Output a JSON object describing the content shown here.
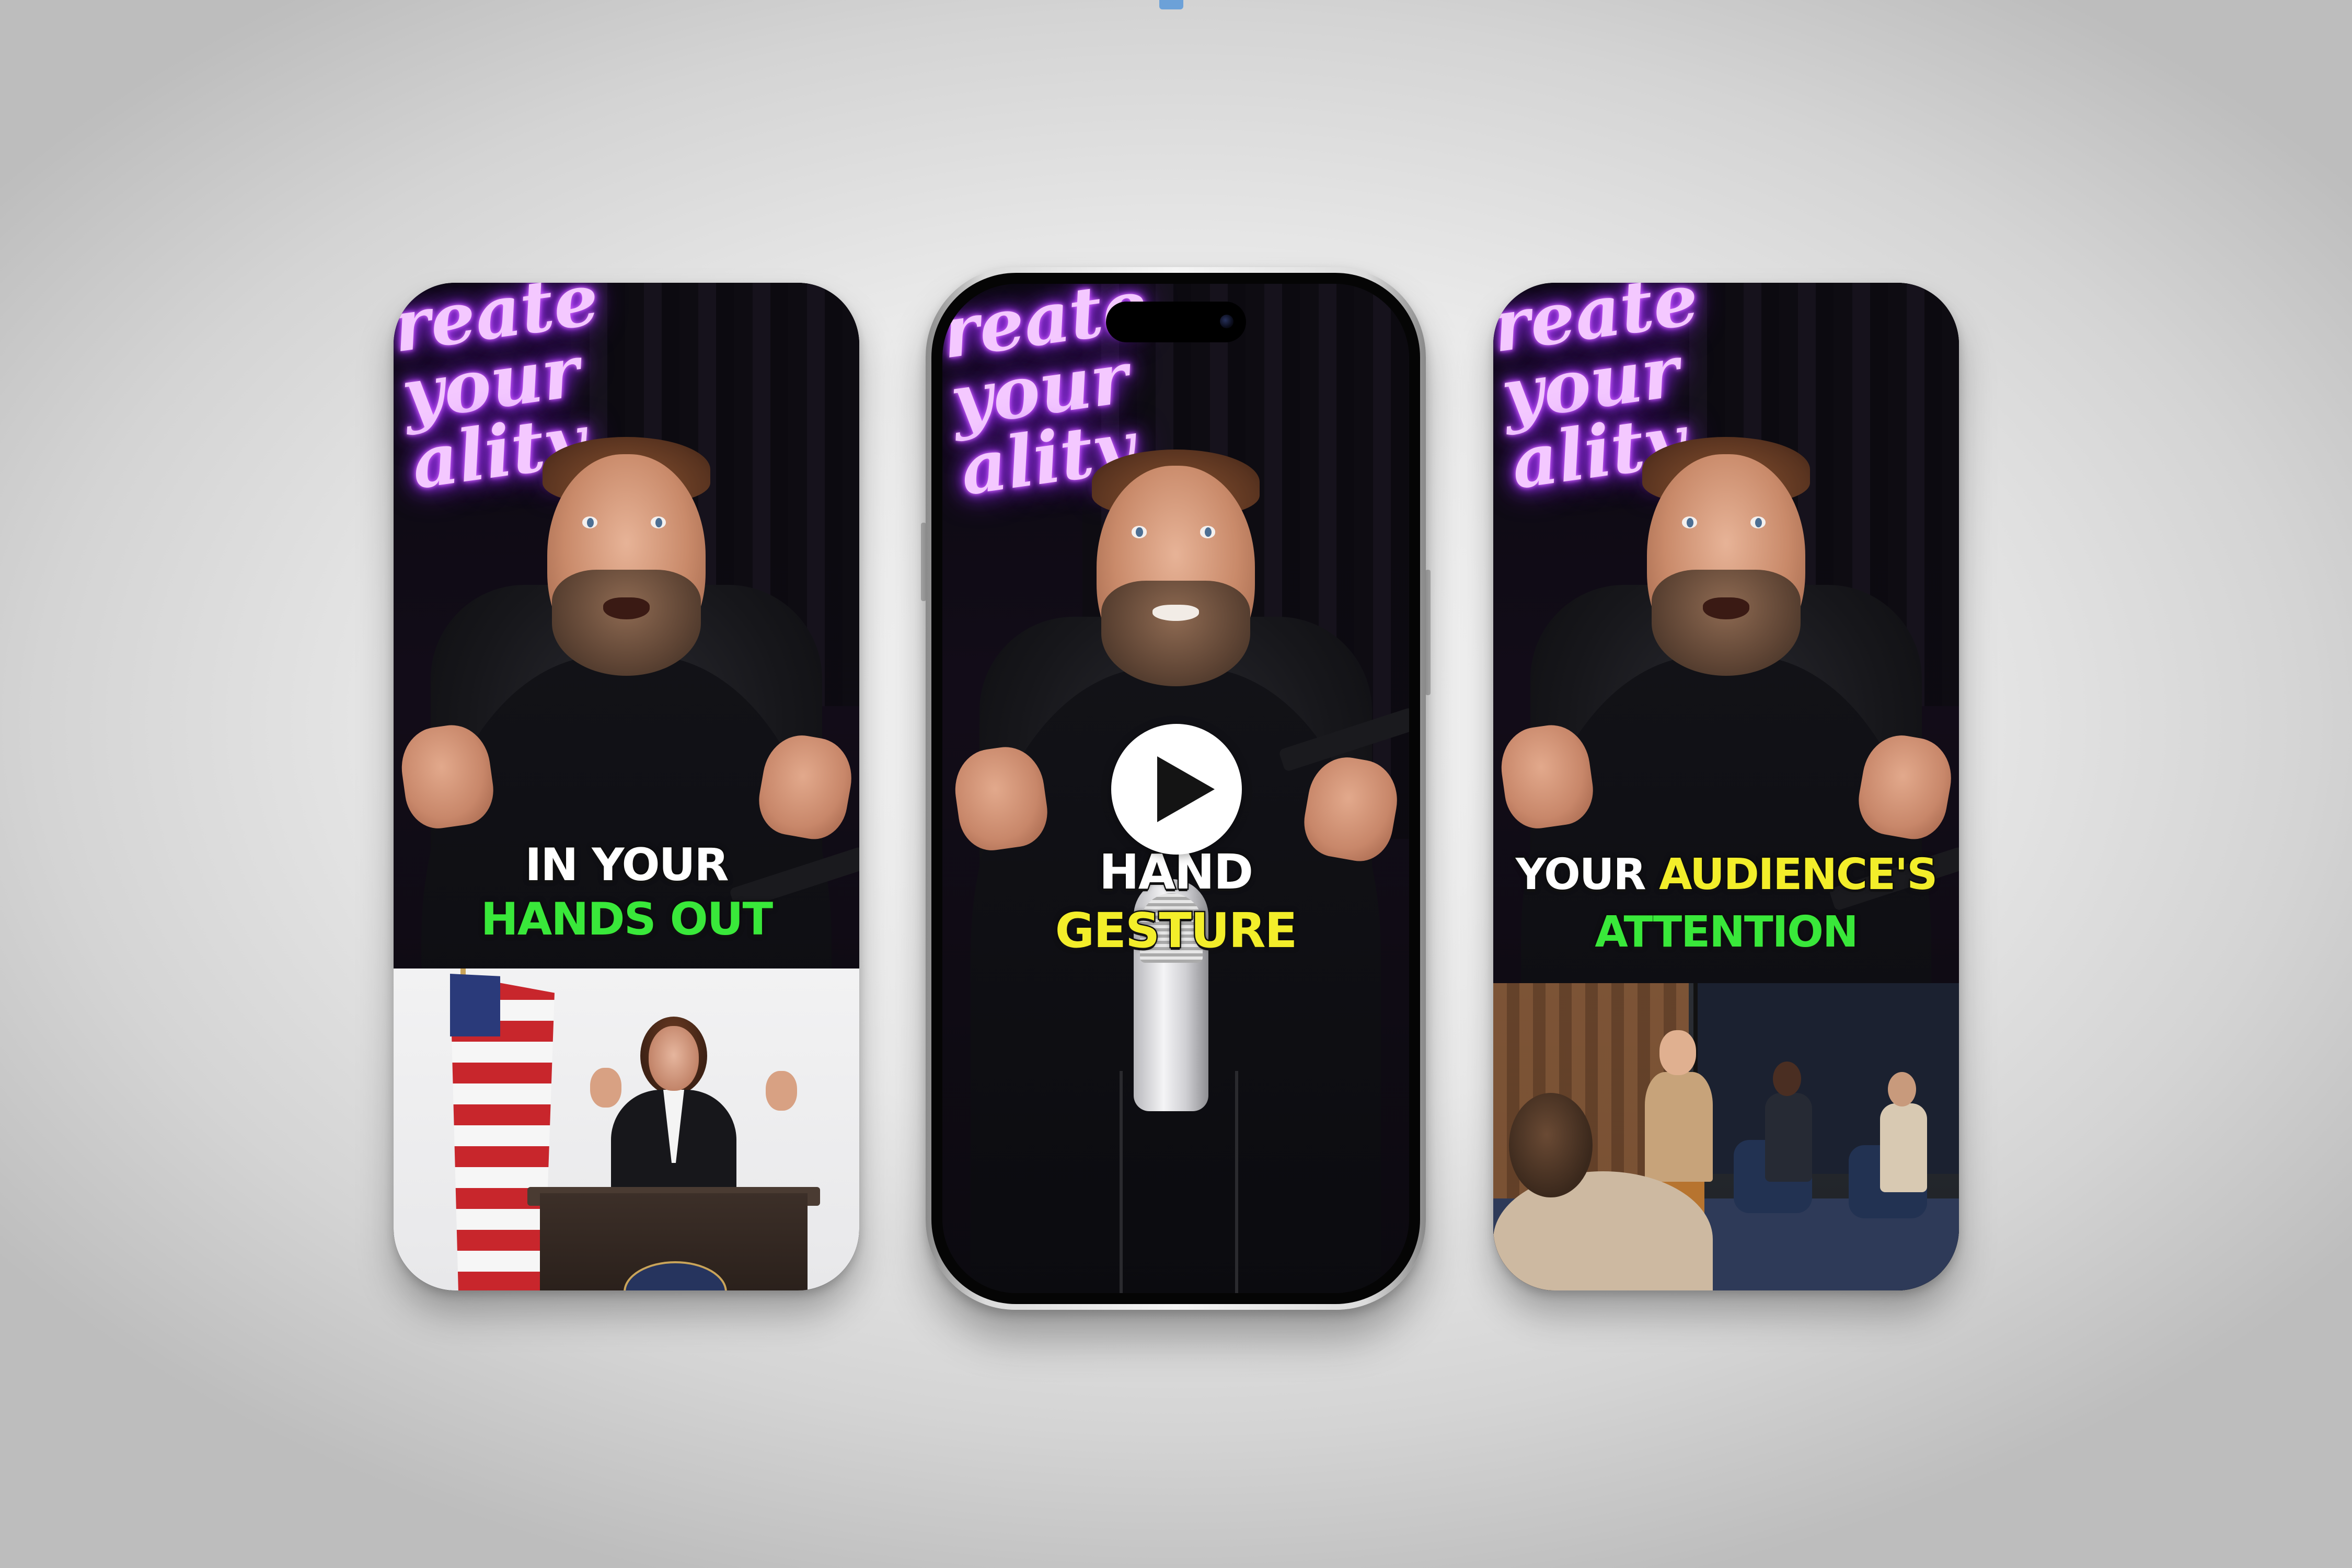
{
  "cards": {
    "left": {
      "caption_line1": "IN YOUR",
      "caption_line2": "HANDS OUT"
    },
    "center": {
      "caption_line1": "HAND",
      "caption_line2": "GESTURE"
    },
    "right": {
      "caption_line1_a": "YOUR",
      "caption_line1_b": "AUDIENCE'S",
      "caption_line2": "ATTENTION"
    }
  },
  "neon_sign": "reate\nyour\nality",
  "colors": {
    "caption_white": "#ffffff",
    "caption_green": "#39e83a",
    "caption_yellow": "#f3ee2a",
    "neon_purple": "#b13cff"
  },
  "icons": {
    "play": "play-icon"
  }
}
